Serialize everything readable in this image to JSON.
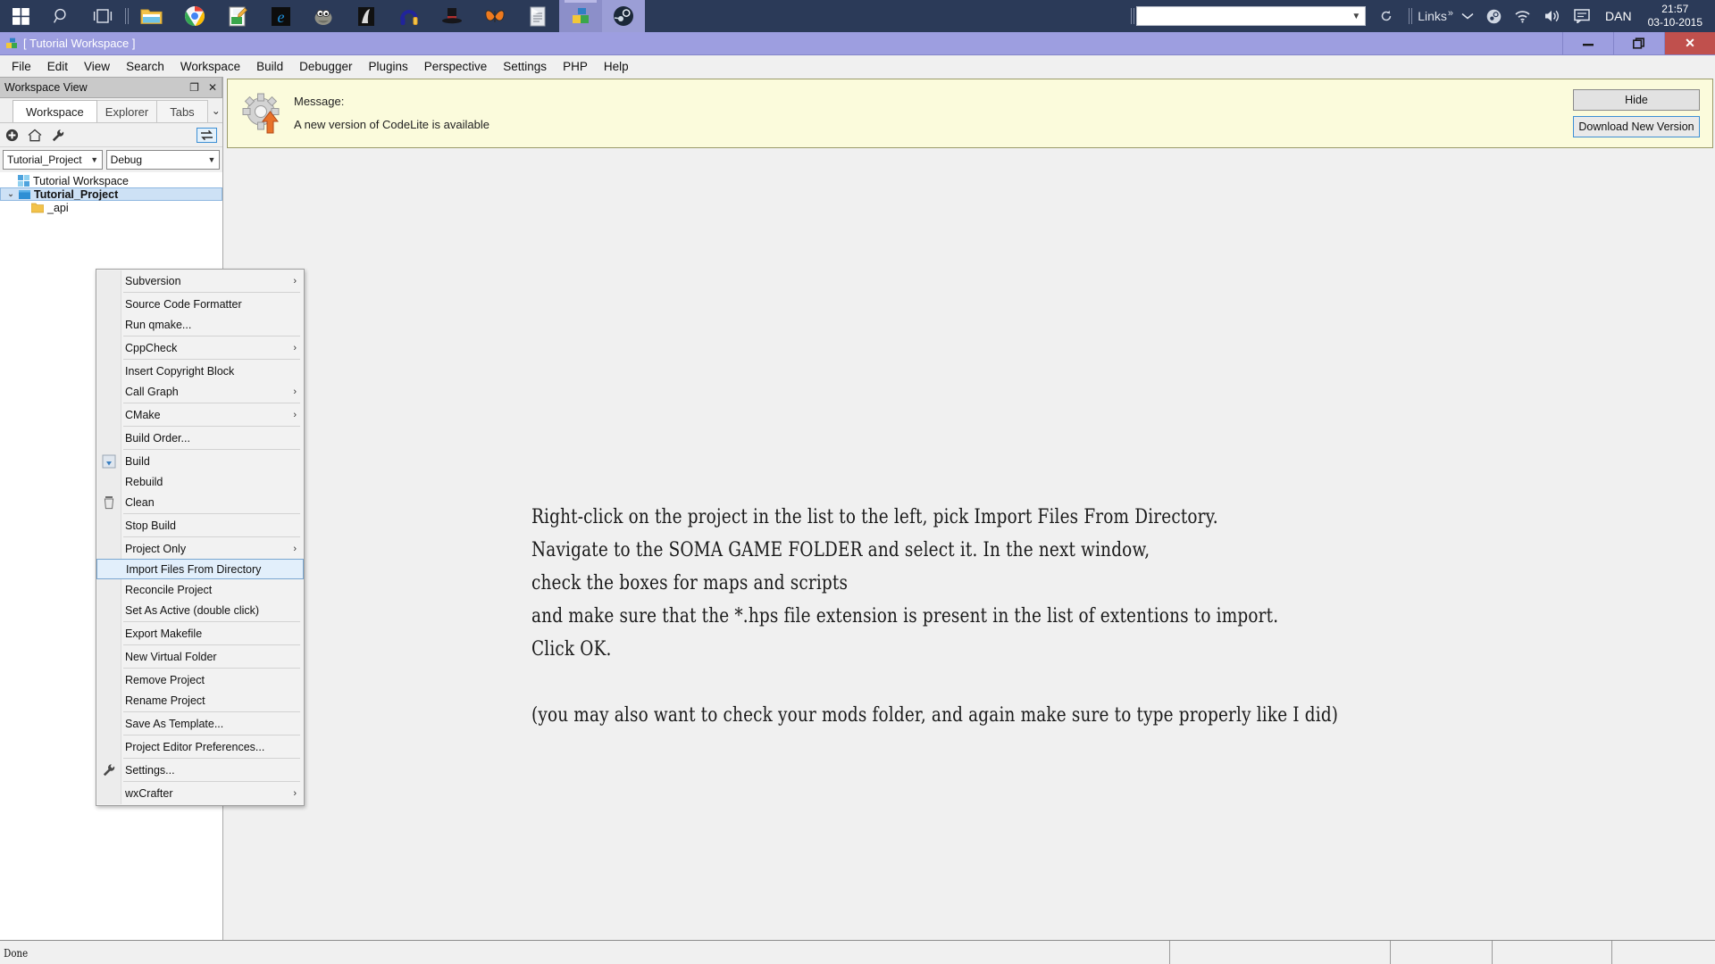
{
  "taskbar": {
    "apps": [
      {
        "name": "start-button",
        "icon": "windows-logo"
      },
      {
        "name": "search",
        "icon": "magnifier-icon"
      },
      {
        "name": "task-view",
        "icon": "task-view-icon"
      },
      {
        "name": "file-explorer",
        "icon": "folder-icon"
      },
      {
        "name": "google-chrome",
        "icon": "chrome-icon"
      },
      {
        "name": "notepad",
        "icon": "notepad-icon"
      },
      {
        "name": "internet-explorer",
        "icon": "edge-icon"
      },
      {
        "name": "gimp",
        "icon": "gimp-icon"
      },
      {
        "name": "inkscape",
        "icon": "inkscape-icon"
      },
      {
        "name": "audacity",
        "icon": "headphones-icon"
      },
      {
        "name": "tophat-app",
        "icon": "tophat-icon"
      },
      {
        "name": "butterfly-app",
        "icon": "butterfly-icon"
      },
      {
        "name": "text-editor",
        "icon": "document-icon"
      },
      {
        "name": "codelite",
        "icon": "codelite-icon"
      },
      {
        "name": "steam",
        "icon": "steam-icon"
      }
    ],
    "address_value": "",
    "links_label": "Links",
    "links_overflow": "»",
    "tray": [
      {
        "name": "show-hidden-icons",
        "icon": "chevron-up-icon"
      },
      {
        "name": "steam-tray",
        "icon": "steam-icon"
      },
      {
        "name": "network",
        "icon": "wifi-icon"
      },
      {
        "name": "volume",
        "icon": "speaker-icon"
      },
      {
        "name": "action-center",
        "icon": "speech-bubble-icon"
      }
    ],
    "user": "DAN",
    "time": "21:57",
    "date": "03-10-2015"
  },
  "window": {
    "title": "[ Tutorial Workspace ]",
    "minimize": "—",
    "maximize": "❐",
    "close": "✕"
  },
  "menubar": [
    "File",
    "Edit",
    "View",
    "Search",
    "Workspace",
    "Build",
    "Debugger",
    "Plugins",
    "Perspective",
    "Settings",
    "PHP",
    "Help"
  ],
  "dock": {
    "caption": "Workspace View",
    "caption_float": "❐",
    "caption_close": "✕",
    "tabs": [
      {
        "label": "Workspace",
        "active": true
      },
      {
        "label": "Explorer",
        "active": false
      },
      {
        "label": "Tabs",
        "active": false
      }
    ],
    "tabs_more": "⌄",
    "tools": [
      {
        "name": "add-icon",
        "glyph": "⊕"
      },
      {
        "name": "home-icon",
        "glyph": "⌂"
      },
      {
        "name": "wrench-icon",
        "glyph": "ὒ7"
      },
      {
        "name": "link-editor-icon",
        "glyph": "⇄"
      }
    ],
    "project_combo": "Tutorial_Project",
    "config_combo": "Debug",
    "tree": [
      {
        "label": "Tutorial Workspace",
        "depth": 0,
        "icon": "workspace-icon",
        "twist": "",
        "selected": false,
        "bold": false
      },
      {
        "label": "Tutorial_Project",
        "depth": 0,
        "icon": "project-icon",
        "twist": "⌄",
        "selected": true,
        "bold": true
      },
      {
        "label": "_api",
        "depth": 1,
        "icon": "folder-icon",
        "twist": "",
        "selected": false,
        "bold": false
      }
    ]
  },
  "notification": {
    "icon": "gear-update-icon",
    "line1": "Message:",
    "line2": "A new version of CodeLite is available",
    "hide_button": "Hide",
    "download_button": "Download New Version"
  },
  "context_menu": {
    "items": [
      {
        "label": "Subversion",
        "submenu": true,
        "icon": "",
        "sep_after": true,
        "highlight": false
      },
      {
        "label": "Source Code Formatter",
        "submenu": false,
        "icon": "",
        "sep_after": false,
        "highlight": false
      },
      {
        "label": "Run qmake...",
        "submenu": false,
        "icon": "",
        "sep_after": true,
        "highlight": false
      },
      {
        "label": "CppCheck",
        "submenu": true,
        "icon": "",
        "sep_after": true,
        "highlight": false
      },
      {
        "label": "Insert Copyright Block",
        "submenu": false,
        "icon": "",
        "sep_after": false,
        "highlight": false
      },
      {
        "label": "Call Graph",
        "submenu": true,
        "icon": "",
        "sep_after": true,
        "highlight": false
      },
      {
        "label": "CMake",
        "submenu": true,
        "icon": "",
        "sep_after": true,
        "highlight": false
      },
      {
        "label": "Build Order...",
        "submenu": false,
        "icon": "",
        "sep_after": true,
        "highlight": false
      },
      {
        "label": "Build",
        "submenu": false,
        "icon": "build-arrow-icon",
        "sep_after": false,
        "highlight": false
      },
      {
        "label": "Rebuild",
        "submenu": false,
        "icon": "",
        "sep_after": false,
        "highlight": false
      },
      {
        "label": "Clean",
        "submenu": false,
        "icon": "trash-icon",
        "sep_after": true,
        "highlight": false
      },
      {
        "label": "Stop Build",
        "submenu": false,
        "icon": "",
        "sep_after": true,
        "highlight": false
      },
      {
        "label": "Project Only",
        "submenu": true,
        "icon": "",
        "sep_after": false,
        "highlight": false
      },
      {
        "label": "Import Files From Directory",
        "submenu": false,
        "icon": "",
        "sep_after": false,
        "highlight": true
      },
      {
        "label": "Reconcile Project",
        "submenu": false,
        "icon": "",
        "sep_after": false,
        "highlight": false
      },
      {
        "label": "Set As Active (double click)",
        "submenu": false,
        "icon": "",
        "sep_after": true,
        "highlight": false
      },
      {
        "label": "Export Makefile",
        "submenu": false,
        "icon": "",
        "sep_after": true,
        "highlight": false
      },
      {
        "label": "New Virtual Folder",
        "submenu": false,
        "icon": "",
        "sep_after": true,
        "highlight": false
      },
      {
        "label": "Remove Project",
        "submenu": false,
        "icon": "",
        "sep_after": false,
        "highlight": false
      },
      {
        "label": "Rename Project",
        "submenu": false,
        "icon": "",
        "sep_after": true,
        "highlight": false
      },
      {
        "label": "Save As Template...",
        "submenu": false,
        "icon": "",
        "sep_after": true,
        "highlight": false
      },
      {
        "label": "Project Editor Preferences...",
        "submenu": false,
        "icon": "",
        "sep_after": true,
        "highlight": false
      },
      {
        "label": "Settings...",
        "submenu": false,
        "icon": "wrench-icon",
        "sep_after": true,
        "highlight": false
      },
      {
        "label": "wxCrafter",
        "submenu": true,
        "icon": "",
        "sep_after": false,
        "highlight": false
      }
    ],
    "submenu_glyph": "›"
  },
  "guide_text": {
    "lines": [
      "Right-click on the project in the list to the left, pick Import Files From Directory.",
      "Navigate to the SOMA GAME FOLDER and select it. In the next window,",
      "check the boxes for maps and scripts",
      "and make sure that the *.hps file extension is present in the list of extentions to import.",
      "Click OK.",
      "",
      "(you may also want to check your mods folder, and again make sure to type properly like I did)"
    ]
  },
  "statusbar": {
    "message": "Done",
    "cells": [
      "",
      "",
      "",
      ""
    ]
  },
  "colors": {
    "taskbar": "#2b3a58",
    "title_bar": "#9d9ee0",
    "close_button": "#c0504d",
    "notification_bg": "#fbfbdc",
    "selection": "#cde1f5",
    "menu_highlight": "#e2effb",
    "accent_border": "#3c8fd4"
  }
}
